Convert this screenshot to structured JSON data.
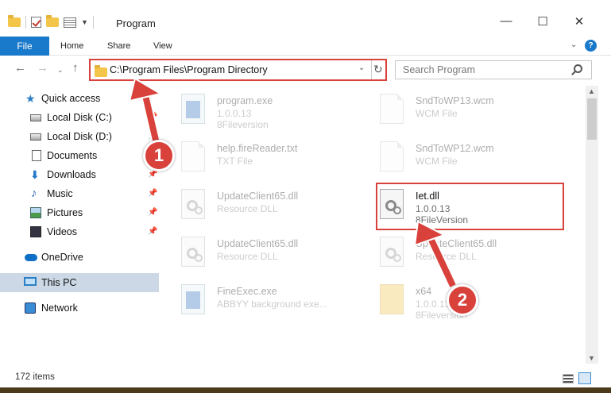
{
  "window": {
    "title": "Program"
  },
  "ribbon": {
    "tabs": [
      "File",
      "Home",
      "Share",
      "View"
    ]
  },
  "nav": {
    "address": "C:\\Program Files\\Program Directory",
    "search_placeholder": "Search Program"
  },
  "sidebar": {
    "items": [
      {
        "label": "Quick access"
      },
      {
        "label": "Local Disk (C:)"
      },
      {
        "label": "Local Disk (D:)"
      },
      {
        "label": "Documents"
      },
      {
        "label": "Downloads"
      },
      {
        "label": "Music"
      },
      {
        "label": "Pictures"
      },
      {
        "label": "Videos"
      },
      {
        "label": "OneDrive"
      },
      {
        "label": "This PC"
      },
      {
        "label": "Network"
      }
    ]
  },
  "files": [
    {
      "name": "program.exe",
      "line1": "1.0.0.13",
      "line2": "8Fileversion"
    },
    {
      "name": "SndToWP13.wcm",
      "line1": "WCM File",
      "line2": ""
    },
    {
      "name": "help.fireReader.txt",
      "line1": "TXT File",
      "line2": ""
    },
    {
      "name": "SndToWP12.wcm",
      "line1": "WCM File",
      "line2": ""
    },
    {
      "name": "UpdateClient65.dll",
      "line1": "Resource DLL",
      "line2": ""
    },
    {
      "name": "Iet.dll",
      "line1": "1.0.0.13",
      "line2": "8FileVersion"
    },
    {
      "name": "UpdateClient65.dll",
      "line1": "Resource DLL",
      "line2": ""
    },
    {
      "name": "UpdateClient65.dll",
      "line1": "Resource DLL",
      "line2": ""
    },
    {
      "name": "FineExec.exe",
      "line1": "ABBYY background exe...",
      "line2": ""
    },
    {
      "name": "x64",
      "line1": "1.0.0.13",
      "line2": "8Fileversion"
    }
  ],
  "status": {
    "item_count": "172 items"
  },
  "callouts": [
    "1",
    "2"
  ],
  "colors": {
    "accent": "#1979ca",
    "highlight": "#d9413b",
    "selection": "#ccd8e6"
  }
}
